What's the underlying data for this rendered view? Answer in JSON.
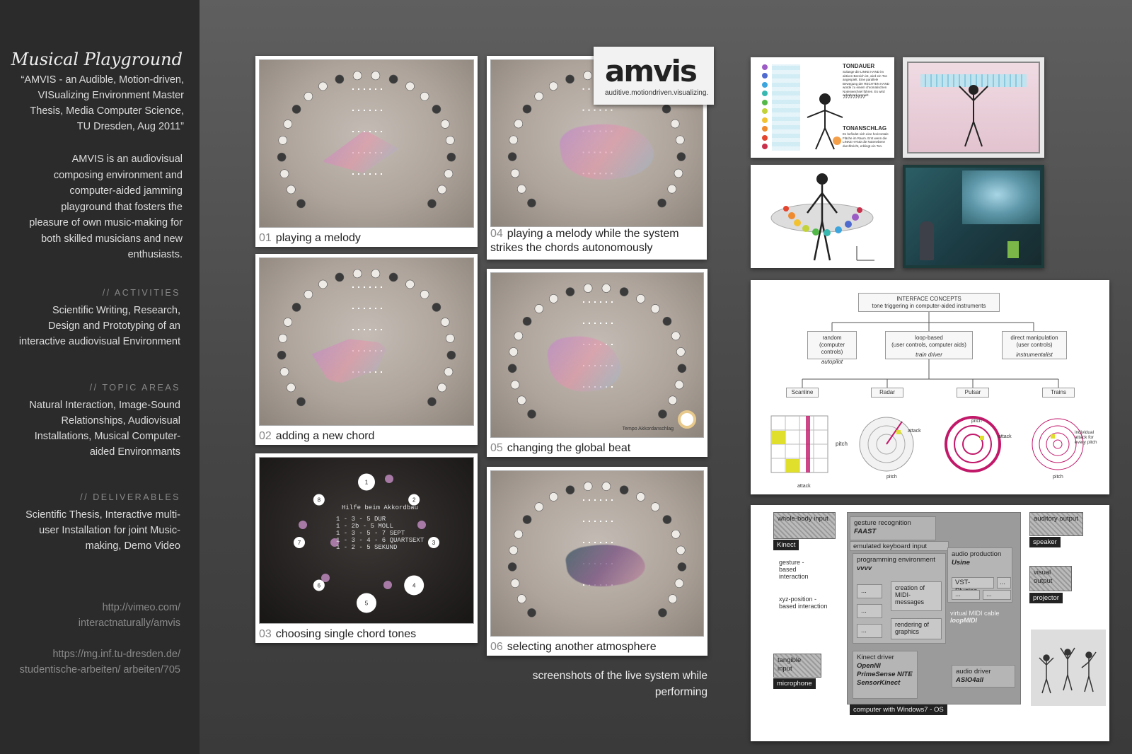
{
  "sidebar": {
    "title": "Musical Playground",
    "subtitle": "“AMVIS - an Audible, Motion-driven, VISualizing Environment Master Thesis, Media Computer Science, TU Dresden, Aug 2011”",
    "intro": "AMVIS is an audiovisual composing environment and computer-aided jamming playground that fosters the pleasure of own music-making for both skilled musicians and new enthusiasts.",
    "activities_heading": "// ACTIVITIES",
    "activities": "Scientific Writing, Research, Design and Prototyping of an interactive audiovisual Environment",
    "topics_heading": "// TOPIC AREAS",
    "topics": "Natural Interaction, Image-Sound Relationships, Audiovisual Installations, Musical Computer-aided Environmants",
    "deliverables_heading": "// DELIVERABLES",
    "deliverables": "Scientific Thesis, Interactive multi-user Installation for joint Music-making, Demo Video",
    "link1": "http://vimeo.com/ interactnaturally/amvis",
    "link2": "https://mg.inf.tu-dresden.de/ studentische-arbeiten/ arbeiten/705"
  },
  "screenshots": [
    {
      "num": "01",
      "label": "playing a melody"
    },
    {
      "num": "02",
      "label": "adding a new chord"
    },
    {
      "num": "03",
      "label": "choosing single chord tones"
    },
    {
      "num": "04",
      "label": "playing a melody while the system strikes the chords autonomously"
    },
    {
      "num": "05",
      "label": "changing the global beat"
    },
    {
      "num": "06",
      "label": "selecting another atmosphere"
    }
  ],
  "shot03": {
    "heading": "Hilfe beim Akkordbau",
    "rows": [
      "1 - 3 - 5  DUR",
      "1 - 2b - 5  MOLL",
      "1 - 3 - 5 - 7  SEPT",
      "1 - 3 - 4 - 6  QUARTSEXT",
      "1 - 2 - 5  SEKUND"
    ],
    "tones": [
      "1",
      "2",
      "3",
      "4",
      "5",
      "6",
      "7",
      "8"
    ],
    "sharp": "#/b"
  },
  "shot05_label": "Tempo Akkordanschlag",
  "logo": {
    "word": "amvis",
    "tagline": "auditive.motiondriven.visualizing."
  },
  "caption": "screenshots of the live system while performing",
  "sketch1": {
    "tondauer": "TONDAUER",
    "tondauer_text": "Solange die LINKE HAND im aktiven Bereich ist, wird ein Ton angespielt. Eine parallele Bewegung der RECHTEN HAND würde zu einem chromatischen Notenwechsel führen. Es wird anhaltend gespielt.",
    "tonanschlag": "TONANSCHLAG",
    "tonanschlag_text": "Es befindet sich eine horizontale Fläche im Raum. Erst wenn die LINKE HAND die Notenebene durchbricht, erklingt ein Ton."
  },
  "concepts": {
    "title": "INTERFACE CONCEPTS",
    "subtitle": "tone triggering in computer-aided instruments",
    "branches": [
      {
        "name": "random",
        "sub": "(computer controls)",
        "role": "autopilot"
      },
      {
        "name": "loop-based",
        "sub": "(user controls, computer aids)",
        "role": "train driver"
      },
      {
        "name": "direct manipulation",
        "sub": "(user controls)",
        "role": "instrumentalist"
      }
    ],
    "types": [
      "Scanline",
      "Radar",
      "Pulsar",
      "Trains"
    ],
    "pitch": "pitch",
    "attack": "attack",
    "individual": "individual attack for every pitch"
  },
  "architecture": {
    "whole_body": "whole-body input",
    "kinect": "Kinect",
    "gesture_based": "gesture - based interaction",
    "xyz_based": "xyz-position - based interaction",
    "tangible": "tangible input",
    "microphone": "microphone",
    "gesture_rec": "gesture recognition",
    "faast": "FAAST",
    "emulated": "emulated keyboard input",
    "prog_env": "programming environment",
    "vvvv": "vvvv",
    "dots": "...",
    "creation": "creation of MIDI-messages",
    "rendering": "rendering of graphics",
    "audio_prod": "audio production",
    "usine": "Usine",
    "vst": "VST-Plugins",
    "virtual_midi": "virtual MIDI cable",
    "loopmidi": "loopMIDI",
    "kinect_driver": "Kinect driver",
    "openni": "OpenNI",
    "primesense": "PrimeSense NITE",
    "sensorkinect": "SensorKinect",
    "audio_driver": "audio driver",
    "asio": "ASIO4all",
    "computer": "computer with Windows7 - OS",
    "auditory": "auditory output",
    "speaker": "speaker",
    "visual": "visual output",
    "projector": "projector"
  }
}
